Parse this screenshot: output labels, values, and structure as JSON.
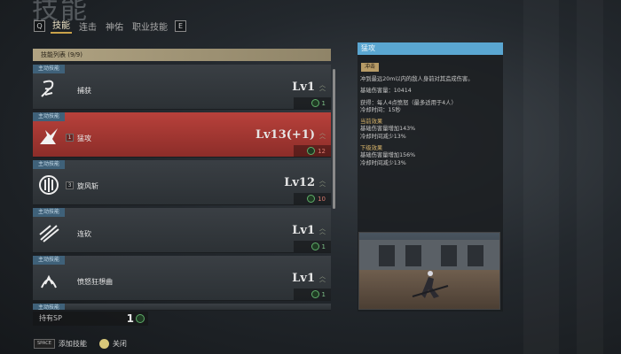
{
  "screen_title": "技能",
  "tabs": {
    "left_key": "Q",
    "right_key": "E",
    "items": [
      "技能",
      "连击",
      "神佑",
      "职业技能"
    ]
  },
  "list": {
    "header": "技能列表 (9/9)",
    "items": [
      {
        "type": "主动技能",
        "name": "捕获",
        "slot": "",
        "level": "Lv1",
        "cost": "1",
        "icon": "grapple-icon"
      },
      {
        "type": "主动技能",
        "name": "猛攻",
        "slot": "1",
        "level": "Lv13(+1)",
        "cost": "12",
        "icon": "assault-icon"
      },
      {
        "type": "主动技能",
        "name": "旋风斩",
        "slot": "3",
        "level": "Lv12",
        "cost": "10",
        "icon": "whirlwind-icon"
      },
      {
        "type": "主动技能",
        "name": "连砍",
        "slot": "",
        "level": "Lv1",
        "cost": "1",
        "icon": "combo-slash-icon"
      },
      {
        "type": "主动技能",
        "name": "愤怒狂想曲",
        "slot": "",
        "level": "Lv1",
        "cost": "1",
        "icon": "rage-rhapsody-icon"
      },
      {
        "type": "主动技能"
      }
    ]
  },
  "sp": {
    "label": "持有SP",
    "value": "1"
  },
  "bottom_actions": {
    "add_key": "SPACE",
    "add_label": "添加技能",
    "close_label": "关闭"
  },
  "detail": {
    "title": "猛攻",
    "tag": "冲击",
    "desc": "冲到最远20m以内的敌人身前对其造成伤害。",
    "base_damage": "基础伤害量：10414",
    "gain": "获得：每人4点愤怒（最多适用于4人）",
    "cooldown": "冷却时间：15秒",
    "current_head": "当前效果",
    "current_line1": "基础伤害量增加143%",
    "current_line2": "冷却时间减少13%",
    "next_head": "下级效果",
    "next_line1": "基础伤害量增加156%",
    "next_line2": "冷却时间减少13%"
  },
  "colors": {
    "selected_row": "#b8413b",
    "type_tag": "#3f6179",
    "detail_title": "#5aa6d1",
    "sp_coin": "#5fae6a",
    "effect_head": "#d9b56b"
  }
}
